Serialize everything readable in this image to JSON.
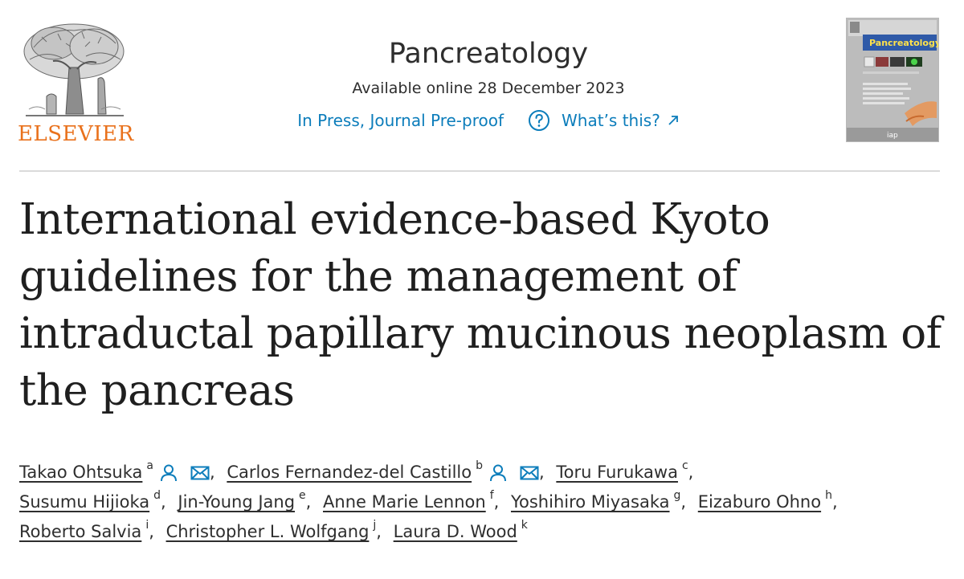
{
  "publisher": {
    "name": "ELSEVIER",
    "brand_color": "#e9711c"
  },
  "journal": {
    "name": "Pancreatology",
    "availability": "Available online 28 December 2023",
    "status_link": "In Press, Journal Pre-proof",
    "help_link": "What’s this?",
    "link_color": "#0c7dbb",
    "cover": {
      "title": "Pancreatology",
      "logo_text": "iap"
    }
  },
  "article": {
    "title_lines": [
      "International evidence-based Kyoto",
      "guidelines for the management of",
      "intraductal papillary mucinous neoplasm of",
      "the pancreas"
    ]
  },
  "authors": [
    {
      "name": "Takao Ohtsuka",
      "affiliation": "a",
      "icons": [
        "person-icon",
        "email-icon"
      ]
    },
    {
      "name": "Carlos Fernandez-del Castillo",
      "affiliation": "b",
      "icons": [
        "person-icon",
        "email-icon"
      ]
    },
    {
      "name": "Toru Furukawa",
      "affiliation": "c"
    },
    {
      "name": "Susumu Hijioka",
      "affiliation": "d"
    },
    {
      "name": "Jin-Young Jang",
      "affiliation": "e"
    },
    {
      "name": "Anne Marie Lennon",
      "affiliation": "f"
    },
    {
      "name": "Yoshihiro Miyasaka",
      "affiliation": "g"
    },
    {
      "name": "Eizaburo Ohno",
      "affiliation": "h"
    },
    {
      "name": "Roberto Salvia",
      "affiliation": "i"
    },
    {
      "name": "Christopher L. Wolfgang",
      "affiliation": "j"
    },
    {
      "name": "Laura D. Wood",
      "affiliation": "k"
    }
  ]
}
